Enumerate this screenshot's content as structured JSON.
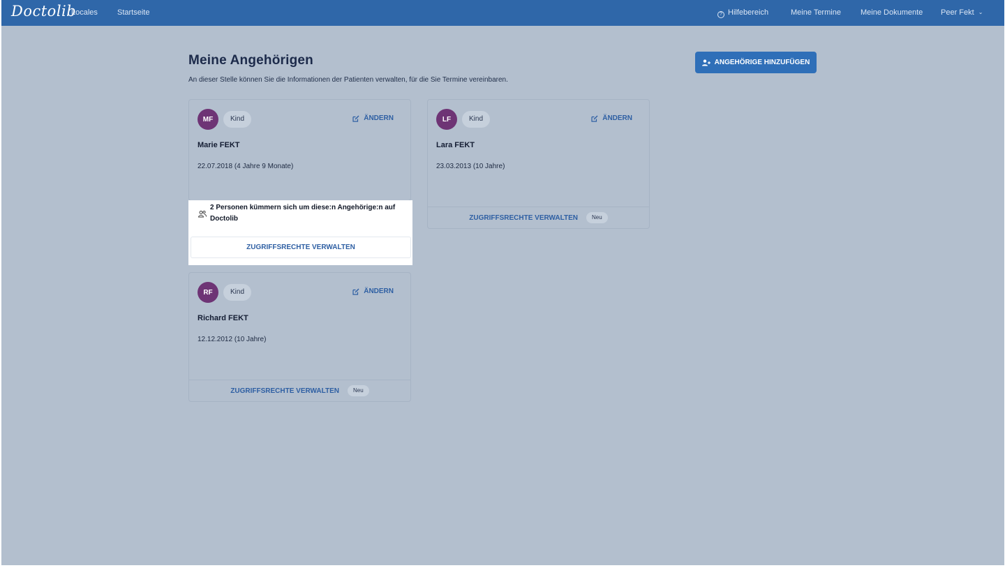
{
  "header": {
    "logo": "Doctolib",
    "nav_left": [
      "Locales",
      "Startseite"
    ],
    "help": "Hilfebereich",
    "appointments": "Meine Termine",
    "documents": "Meine Dokumente",
    "user": "Peer Fekt"
  },
  "page": {
    "title": "Meine Angehörigen",
    "subtitle": "An dieser Stelle können Sie die Informationen der Patienten verwalten, für die Sie Termine vereinbaren.",
    "add_button": "ANGEHÖRIGE HINZUFÜGEN"
  },
  "relatives": [
    {
      "initials": "MF",
      "tag": "Kind",
      "edit": "ÄNDERN",
      "name": "Marie FEKT",
      "dob": "22.07.2018 (4 Jahre 9 Monate)"
    },
    {
      "initials": "LF",
      "tag": "Kind",
      "edit": "ÄNDERN",
      "name": "Lara FEKT",
      "dob": "23.03.2013 (10 Jahre)",
      "access_label": "ZUGRIFFSRECHTE VERWALTEN",
      "badge": "Neu"
    },
    {
      "initials": "RF",
      "tag": "Kind",
      "edit": "ÄNDERN",
      "name": "Richard FEKT",
      "dob": "12.12.2012 (10 Jahre)",
      "access_label": "ZUGRIFFSRECHTE VERWALTEN",
      "badge": "Neu"
    }
  ],
  "highlight": {
    "text": "2 Personen kümmern sich um diese:n Angehörige:n auf Doctolib",
    "button": "ZUGRIFFSRECHTE VERWALTEN"
  },
  "colors": {
    "topbar": "#2f67a9",
    "backdrop": "#b3bfce",
    "avatar": "#6e3475",
    "link": "#2e5fa3"
  }
}
